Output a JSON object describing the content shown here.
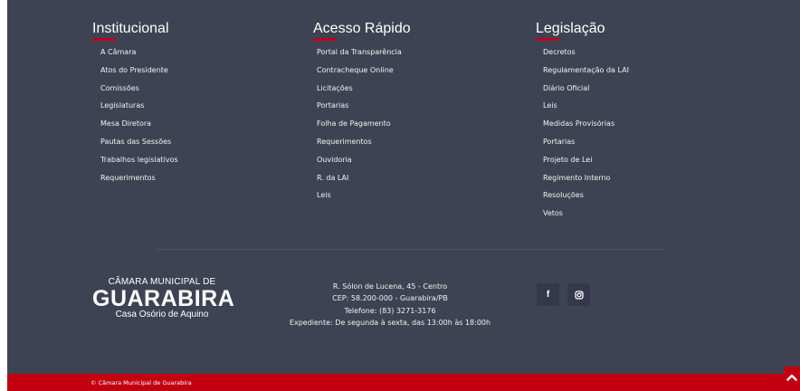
{
  "columns": [
    {
      "title": "Institucional",
      "links": [
        "A Câmara",
        "Atos do Presidente",
        "Comissões",
        "Legislaturas",
        "Mesa Diretora",
        "Pautas das Sessões",
        "Trabalhos legislativos",
        "Requerimentos"
      ]
    },
    {
      "title": "Acesso Rápido",
      "links": [
        "Portal da Transparência",
        "Contracheque Online",
        "Licitações",
        "Portarias",
        "Folha de Pagamento",
        "Requerimentos",
        "Ouvidoria",
        "R. da LAI",
        "Leis"
      ]
    },
    {
      "title": "Legislação",
      "links": [
        "Decretos",
        "Regulamentação da LAI",
        "Diário Oficial",
        "Leis",
        "Medidas Provisórias",
        "Portarias",
        "Projeto de Lei",
        "Regimento Interno",
        "Resoluções",
        "Vetos"
      ]
    }
  ],
  "logo": {
    "top": "CÂMARA MUNICIPAL DE",
    "main": "GUARABIRA",
    "sub": "Casa Osório de Aquino"
  },
  "address": {
    "street": "R. Sólon de Lucena, 45 - Centro",
    "cep": "CEP: 58.200-000 - Guarabira/PB",
    "phone": "Telefone: (83) 3271-3176",
    "hours": "Expediente: De segunda à sexta, das 13:00h às 18:00h"
  },
  "social": [
    {
      "icon": "facebook-icon"
    },
    {
      "icon": "instagram-icon"
    }
  ],
  "copyright": "© Câmara Municipal de Guarabira",
  "colors": {
    "footer_bg": "#3e4353",
    "accent": "#c3000f",
    "social_bg": "#34384a",
    "text": "#ffffff"
  }
}
